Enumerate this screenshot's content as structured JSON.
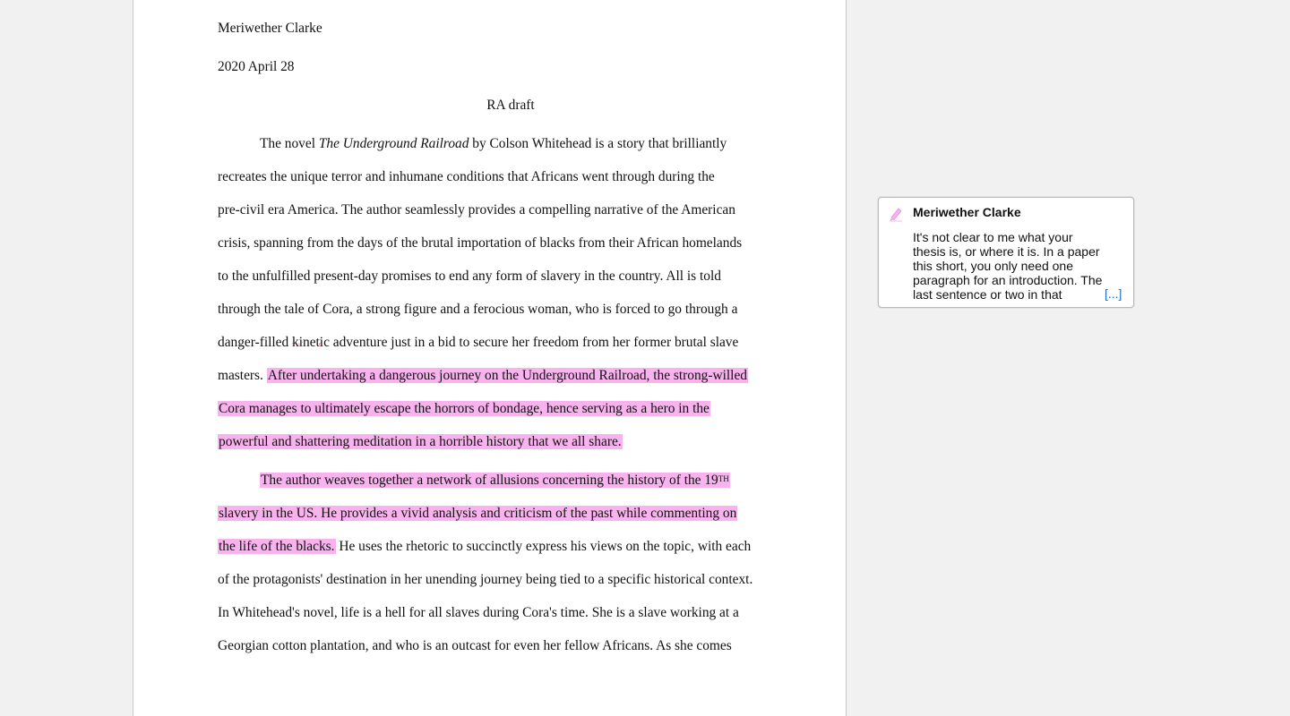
{
  "document": {
    "author": "Meriwether Clarke",
    "date": "2020 April 28",
    "title": "RA draft",
    "p1": {
      "l1_pre": "The novel ",
      "l1_book": "The Underground Railroad",
      "l1_post": " by Colson Whitehead is a story that brilliantly",
      "l2": "recreates the unique terror and inhumane conditions that Africans went through during the",
      "l3": "pre-civil era America. The author seamlessly provides a compelling narrative of the American",
      "l4": "crisis, spanning from the days of the brutal importation of blacks from their African homelands",
      "l5": "to the unfulfilled present-day promises to end any form of slavery in the country. All is told",
      "l6": "through the tale of Cora, a strong figure and a ferocious woman, who is forced to go through a",
      "l7_pre": "danger-filled ",
      "l7_misspelled": "kinetic",
      "l7_post": " adventure just in a bid to secure her freedom from her former brutal slave",
      "l8_plain": "masters. ",
      "l8_hl": "After undertaking a dangerous journey on the Underground Railroad, the strong-willed",
      "l9_hl": "Cora manages to ultimately escape the horrors of bondage, hence serving as a hero in the",
      "l10_hl": "powerful and shattering meditation in a horrible history that we all share."
    },
    "p2": {
      "l1_hl": "The author weaves together a network of allusions concerning the history of the 19",
      "l1_sup": "TH",
      "l2_hl": "slavery in the US. He provides a vivid analysis and criticism of the past while commenting on",
      "l3_hl": "the life of the blacks.",
      "l3_plain": " He uses the rhetoric to succinctly express his views on the topic, with each",
      "l4": "of the protagonists' destination in her unending journey being tied to a specific historical context.",
      "l5": "In Whitehead's novel, life is a hell for all slaves during Cora's time. She is a slave working at a",
      "l6": "Georgian cotton plantation, and who is an outcast for even her fellow Africans. As she comes"
    }
  },
  "comment": {
    "author": "Meriwether Clarke",
    "text": "It's not clear to me what your thesis is, or where it is. In a paper this short, you only need one paragraph for an introduction. The last sentence or two in that paragraph",
    "more_label": "[...]",
    "icon": "highlighter-icon",
    "highlight_color": "#f8b3ee"
  }
}
